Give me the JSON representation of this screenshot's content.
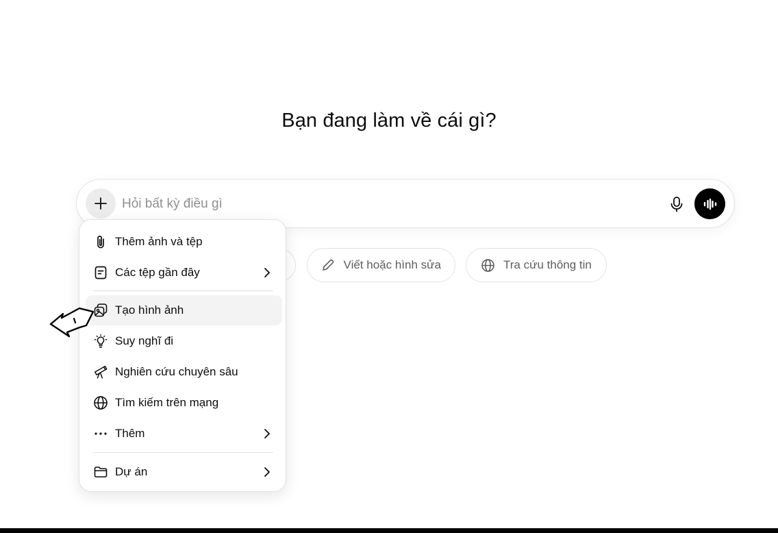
{
  "headline": "Bạn đang làm về cái gì?",
  "composer": {
    "placeholder": "Hỏi bất kỳ điều gì",
    "value": ""
  },
  "icons": {
    "plus": "plus-icon",
    "mic": "microphone-icon",
    "voice": "voice-waveform-icon",
    "pencil": "pencil-icon",
    "globe": "globe-icon",
    "chevron": "chevron-right-icon",
    "pointer": "pointer-arrow-icon"
  },
  "chips": [
    {
      "label": ""
    },
    {
      "label": "Viết hoặc hình sửa"
    },
    {
      "label": "Tra cứu thông tin"
    }
  ],
  "menu": {
    "items": [
      {
        "label": "Thêm ảnh và tệp",
        "icon": "paperclip-icon"
      },
      {
        "label": "Các tệp gần đây",
        "icon": "document-icon",
        "has_submenu": true
      },
      {
        "label": "Tạo hình ảnh",
        "icon": "image-create-icon",
        "active": true
      },
      {
        "label": "Suy nghĩ đi",
        "icon": "lightbulb-icon"
      },
      {
        "label": "Nghiên cứu chuyên sâu",
        "icon": "telescope-icon"
      },
      {
        "label": "Tìm kiếm trên mạng",
        "icon": "globe-icon"
      },
      {
        "label": "Thêm",
        "icon": "more-dots-icon",
        "has_submenu": true
      },
      {
        "label": "Dự án",
        "icon": "folder-icon",
        "has_submenu": true
      }
    ]
  },
  "colors": {
    "text": "#0d0d0d",
    "placeholder": "#8f8f8f",
    "chip_text": "#5d5d5d",
    "border": "#e3e3e3",
    "active_bg": "#f3f3f3",
    "voice_button": "#000000"
  }
}
